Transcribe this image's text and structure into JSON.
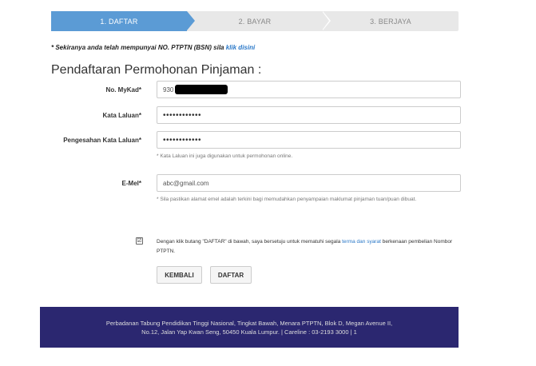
{
  "stepper": {
    "steps": [
      "1. DAFTAR",
      "2. BAYAR",
      "3. BERJAYA"
    ],
    "active_color": "#5b9bd5"
  },
  "notice": {
    "text": "* Sekiranya anda telah mempunyai NO. PTPTN (BSN) sila ",
    "link": "klik disini"
  },
  "page_title": "Pendaftaran Permohonan Pinjaman :",
  "form": {
    "mykad_label": "No. MyKad*",
    "mykad_value": "930",
    "password_label": "Kata Laluan*",
    "password_value": "••••••••••••",
    "confirm_label": "Pengesahan Kata Laluan*",
    "confirm_value": "••••••••••••",
    "password_help": "* Kata Laluan ini juga digunakan untuk permohonan online.",
    "email_label": "E-Mel*",
    "email_value": "abc@gmail.com",
    "email_help": "* Sila pastikan alamat emel adalah terkini bagi memudahkan penyampaian maklumat pinjaman tuan/puan dibuat."
  },
  "agreement": {
    "text_before": "Dengan klik butang \"DAFTAR\" di bawah, saya bersetuju untuk mematuhi segala ",
    "link": "terma dan syarat",
    "text_after": " berkenaan pembelian Nombor PTPTN.",
    "checked_glyph": "☑"
  },
  "buttons": {
    "back": "KEMBALI",
    "submit": "DAFTAR"
  },
  "footer": {
    "line1": "Perbadanan Tabung Pendidikan Tinggi Nasional, Tingkat Bawah, Menara PTPTN, Blok D, Megan Avenue II,",
    "line2": "No.12, Jalan Yap Kwan Seng, 50450 Kuala Lumpur. | Careline : 03-2193 3000 | 1",
    "background": "#2b2770"
  }
}
